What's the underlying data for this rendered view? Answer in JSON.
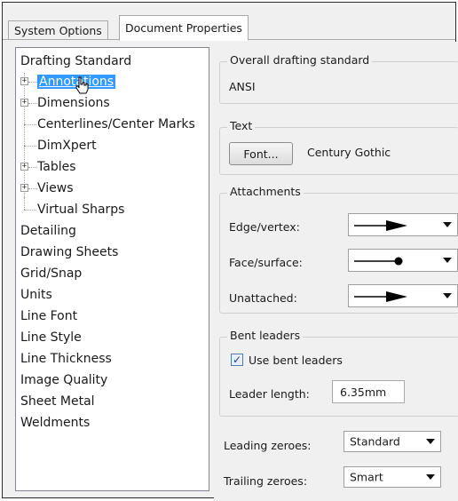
{
  "tabs": {
    "system_options": "System Options",
    "document_properties": "Document Properties"
  },
  "tree": {
    "items": [
      {
        "label": "Drafting Standard"
      },
      {
        "label": "Annotations"
      },
      {
        "label": "Dimensions"
      },
      {
        "label": "Centerlines/Center Marks"
      },
      {
        "label": "DimXpert"
      },
      {
        "label": "Tables"
      },
      {
        "label": "Views"
      },
      {
        "label": "Virtual Sharps"
      },
      {
        "label": "Detailing"
      },
      {
        "label": "Drawing Sheets"
      },
      {
        "label": "Grid/Snap"
      },
      {
        "label": "Units"
      },
      {
        "label": "Line Font"
      },
      {
        "label": "Line Style"
      },
      {
        "label": "Line Thickness"
      },
      {
        "label": "Image Quality"
      },
      {
        "label": "Sheet Metal"
      },
      {
        "label": "Weldments"
      }
    ],
    "selected": "Annotations"
  },
  "overall": {
    "legend": "Overall drafting standard",
    "value": "ANSI"
  },
  "text_group": {
    "legend": "Text",
    "font_button": "Font...",
    "font_name": "Century Gothic"
  },
  "attachments": {
    "legend": "Attachments",
    "edge_label": "Edge/vertex:",
    "edge_value": "filled-arrow",
    "face_label": "Face/surface:",
    "face_value": "dot",
    "unattached_label": "Unattached:",
    "unattached_value": "filled-arrow"
  },
  "bent": {
    "legend": "Bent leaders",
    "checkbox_label": "Use bent leaders",
    "checked": true,
    "length_label": "Leader length:",
    "length_value": "6.35mm"
  },
  "zeroes": {
    "leading_label": "Leading zeroes:",
    "leading_value": "Standard",
    "trailing_label": "Trailing zeroes:",
    "trailing_value": "Smart"
  }
}
